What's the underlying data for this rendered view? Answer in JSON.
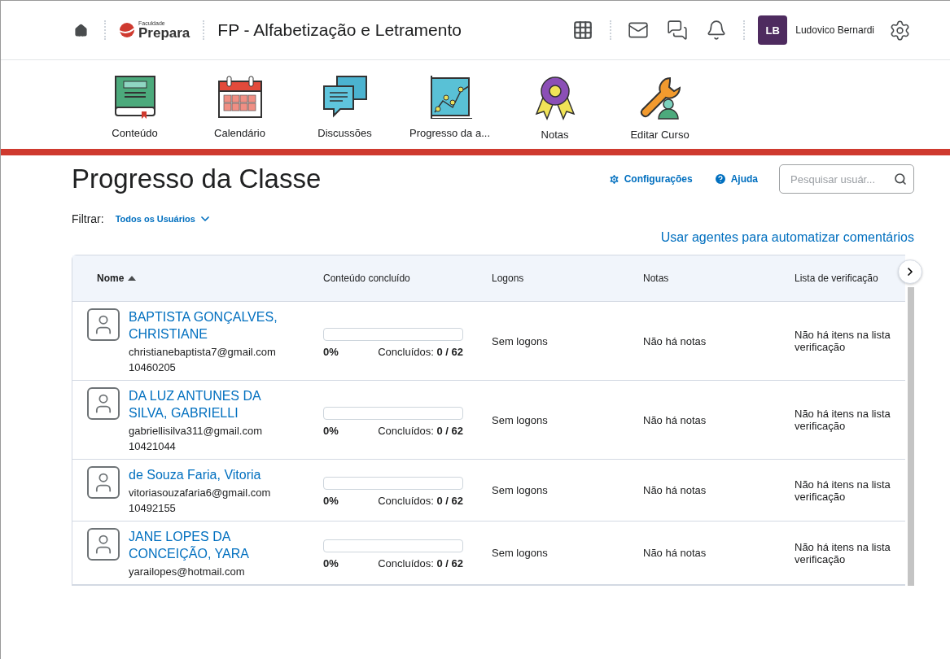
{
  "header": {
    "logo": {
      "tagline": "Faculdade",
      "name": "Prepara"
    },
    "course_title": "FP - Alfabetização e Letramento",
    "user": {
      "initials": "LB",
      "name": "Ludovico Bernardi"
    }
  },
  "nav": [
    {
      "kind": "book",
      "label": "Conteúdo"
    },
    {
      "kind": "calendar",
      "label": "Calendário"
    },
    {
      "kind": "discussions",
      "label": "Discussões"
    },
    {
      "kind": "chart",
      "label": "Progresso da a..."
    },
    {
      "kind": "award",
      "label": "Notas"
    },
    {
      "kind": "wrench",
      "label": "Editar Curso"
    }
  ],
  "page": {
    "title": "Progresso da Classe",
    "actions": [
      {
        "kind": "settings",
        "label": "Configurações"
      },
      {
        "kind": "help",
        "label": "Ajuda"
      }
    ],
    "search": {
      "placeholder": "Pesquisar usuár..."
    },
    "filter": {
      "label": "Filtrar:",
      "value": "Todos os Usuários"
    },
    "link": "Usar agentes para automatizar comentários"
  },
  "table": {
    "columns": [
      {
        "label": "Nome",
        "sorted": true
      },
      {
        "label": "Conteúdo concluído",
        "sorted": false
      },
      {
        "label": "Logons",
        "sorted": false
      },
      {
        "label": "Notas",
        "sorted": false
      },
      {
        "label": "Lista de verificação",
        "sorted": false
      }
    ],
    "rows": [
      {
        "name": "BAPTISTA GONÇALVES, CHRISTIANE",
        "email": "christianebaptista7@gmail.com",
        "id": "10460205",
        "progress": {
          "level": 0,
          "percent": "0%",
          "label": "Concluídos:",
          "count": "0 / 62"
        },
        "logons": "Sem logons",
        "notas": "Não há notas",
        "checklist": "Não há itens na lista verificação"
      },
      {
        "name": "DA LUZ ANTUNES DA SILVA, GABRIELLI",
        "email": "gabriellisilva311@gmail.com",
        "id": "10421044",
        "progress": {
          "level": 0,
          "percent": "0%",
          "label": "Concluídos:",
          "count": "0 / 62"
        },
        "logons": "Sem logons",
        "notas": "Não há notas",
        "checklist": "Não há itens na lista verificação"
      },
      {
        "name": "de Souza Faria, Vitoria",
        "email": "vitoriasouzafaria6@gmail.com",
        "id": "10492155",
        "progress": {
          "level": 0,
          "percent": "0%",
          "label": "Concluídos:",
          "count": "0 / 62"
        },
        "logons": "Sem logons",
        "notas": "Não há notas",
        "checklist": "Não há itens na lista verificação"
      },
      {
        "name": "JANE LOPES DA CONCEIÇÃO, YARA",
        "email": "yarailopes@hotmail.com",
        "progress": {
          "level": 0,
          "percent": "0%",
          "label": "Concluídos:",
          "count": "0 / 62"
        },
        "logons": "Sem logons",
        "notas": "Não há notas",
        "checklist": "Não há itens na lista verificação"
      }
    ]
  }
}
